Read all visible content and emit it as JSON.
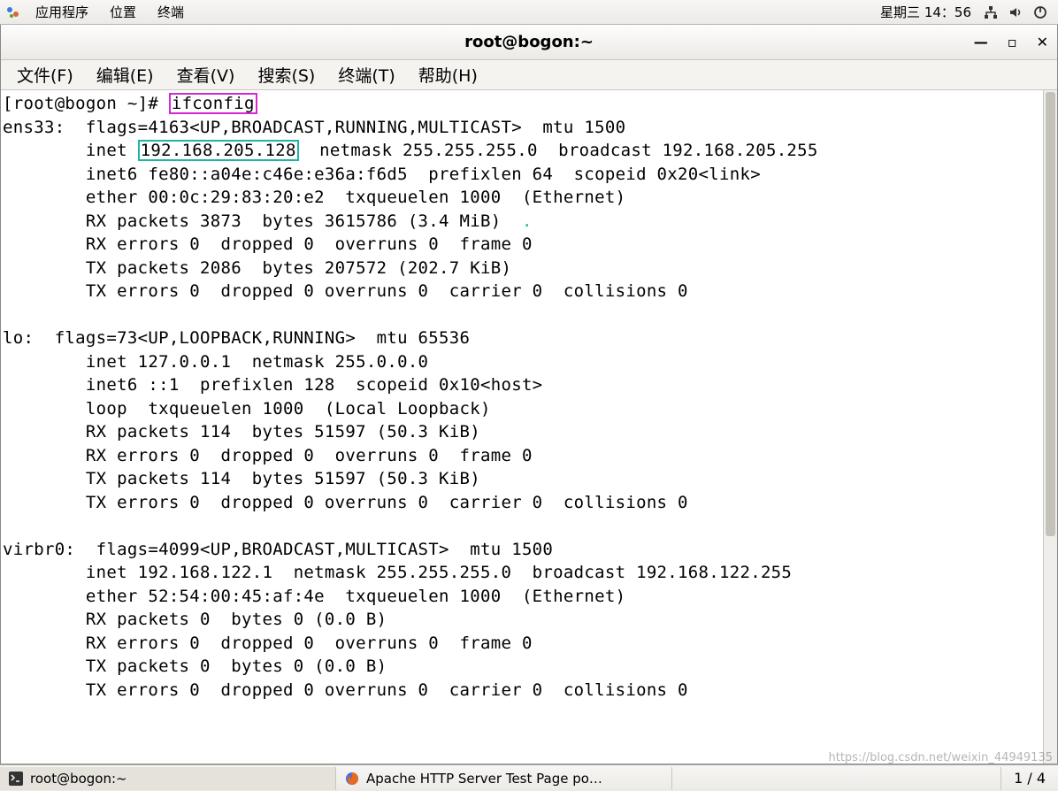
{
  "panel": {
    "apps": "应用程序",
    "places": "位置",
    "terminal": "终端",
    "clock": "星期三 14：56"
  },
  "window": {
    "title": "root@bogon:~"
  },
  "menubar": {
    "file": "文件(F)",
    "edit": "编辑(E)",
    "view": "查看(V)",
    "search": "搜索(S)",
    "terminal": "终端(T)",
    "help": "帮助(H)"
  },
  "term": {
    "prompt_left": "[root@bogon ~]# ",
    "cmd": "ifconfig",
    "ens33_l1": "ens33:  flags=4163<UP,BROADCAST,RUNNING,MULTICAST>  mtu 1500",
    "ens33_l2a": "        inet ",
    "ens33_ip": "192.168.205.128",
    "ens33_l2b": "  netmask 255.255.255.0  broadcast 192.168.205.255",
    "ens33_l3": "        inet6 fe80::a04e:c46e:e36a:f6d5  prefixlen 64  scopeid 0x20<link>",
    "ens33_l4": "        ether 00:0c:29:83:20:e2  txqueuelen 1000  (Ethernet)",
    "ens33_l5a": "        RX packets 3873  bytes 3615786 (3.4 MiB)  ",
    "ens33_l5_dot": ".",
    "ens33_l6": "        RX errors 0  dropped 0  overruns 0  frame 0",
    "ens33_l7": "        TX packets 2086  bytes 207572 (202.7 KiB)",
    "ens33_l8": "        TX errors 0  dropped 0 overruns 0  carrier 0  collisions 0",
    "blank": "",
    "lo_l1": "lo:  flags=73<UP,LOOPBACK,RUNNING>  mtu 65536",
    "lo_l2": "        inet 127.0.0.1  netmask 255.0.0.0",
    "lo_l3": "        inet6 ::1  prefixlen 128  scopeid 0x10<host>",
    "lo_l4": "        loop  txqueuelen 1000  (Local Loopback)",
    "lo_l5": "        RX packets 114  bytes 51597 (50.3 KiB)",
    "lo_l6": "        RX errors 0  dropped 0  overruns 0  frame 0",
    "lo_l7": "        TX packets 114  bytes 51597 (50.3 KiB)",
    "lo_l8": "        TX errors 0  dropped 0 overruns 0  carrier 0  collisions 0",
    "virbr0_l1": "virbr0:  flags=4099<UP,BROADCAST,MULTICAST>  mtu 1500",
    "virbr0_l2": "        inet 192.168.122.1  netmask 255.255.255.0  broadcast 192.168.122.255",
    "virbr0_l3": "        ether 52:54:00:45:af:4e  txqueuelen 1000  (Ethernet)",
    "virbr0_l4": "        RX packets 0  bytes 0 (0.0 B)",
    "virbr0_l5": "        RX errors 0  dropped 0  overruns 0  frame 0",
    "virbr0_l6": "        TX packets 0  bytes 0 (0.0 B)",
    "virbr0_l7": "        TX errors 0  dropped 0 overruns 0  carrier 0  collisions 0"
  },
  "taskbar": {
    "task1": "root@bogon:~",
    "task2": "Apache HTTP Server Test Page po…",
    "workspace": "1 / 4"
  },
  "watermark": "https://blog.csdn.net/weixin_44949135"
}
